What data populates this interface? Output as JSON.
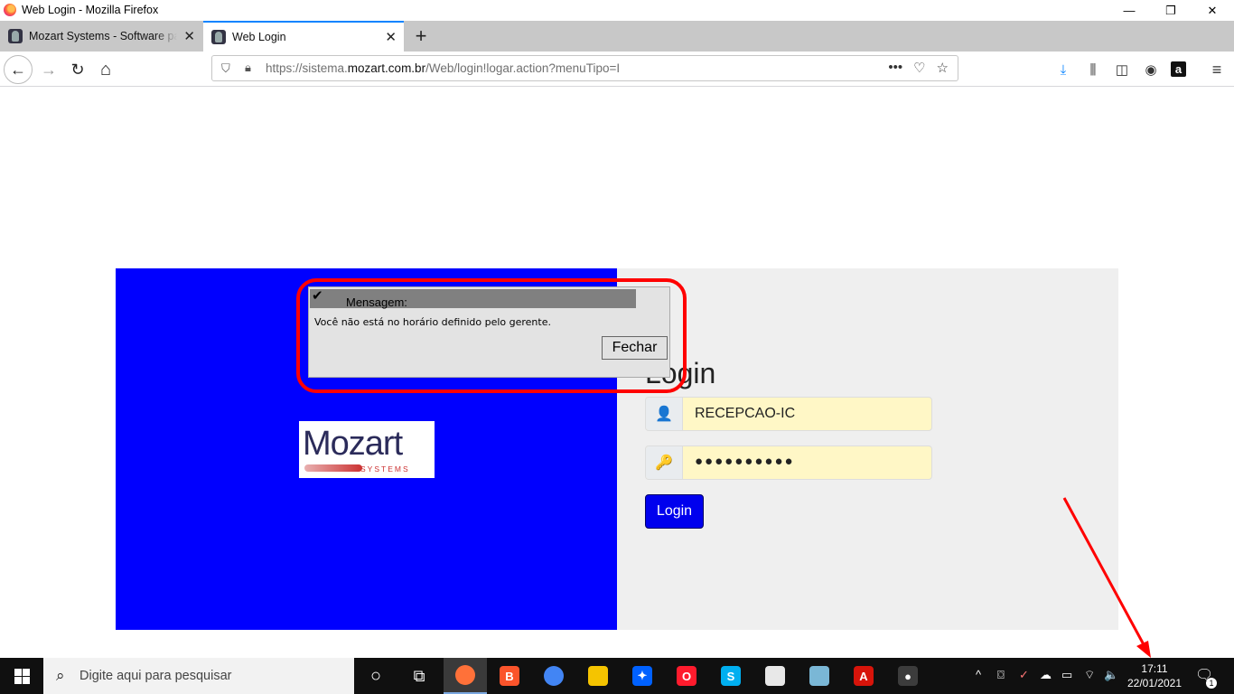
{
  "window": {
    "title": "Web Login - Mozilla Firefox",
    "minimize": "—",
    "restore": "❐",
    "close": "✕"
  },
  "tabs": [
    {
      "label": "Mozart Systems - Software para",
      "close": "✕"
    },
    {
      "label": "Web Login",
      "close": "✕"
    }
  ],
  "new_tab": "+",
  "nav": {
    "back": "←",
    "forward": "→",
    "reload": "↻",
    "home": "⌂",
    "url_pre": "https://sistema.",
    "url_domain": "mozart.com.br",
    "url_post": "/Web/login!logar.action?menuTipo=I",
    "page_actions": "•••",
    "pocket": "♡",
    "bookmark": "☆",
    "download": "⤓",
    "library": "⫼",
    "sidebar": "◫",
    "account": "◉",
    "amazon": "a",
    "menu": "≡"
  },
  "logo": {
    "word": "Mozart",
    "sub": "SYSTEMS"
  },
  "login": {
    "title": "Login",
    "username": "RECEPCAO-IC",
    "password": "●●●●●●●●●●",
    "button": "Login",
    "user_icon": "👤",
    "key_icon": "🔑"
  },
  "dialog": {
    "check": "✔",
    "title": "Mensagem:",
    "message": "Você não está no horário definido pelo gerente.",
    "close_button": "Fechar"
  },
  "taskbar": {
    "search_placeholder": "Digite aqui para pesquisar",
    "search_icon": "⌕",
    "cortana": "○",
    "task_view": "⧉",
    "apps": [
      {
        "name": "firefox",
        "glyph": "",
        "color": "#ff7139"
      },
      {
        "name": "brave",
        "glyph": "B",
        "color": "#fb542b"
      },
      {
        "name": "chrome",
        "glyph": "",
        "color": "#4285f4"
      },
      {
        "name": "file-explorer",
        "glyph": "",
        "color": "#f5c400"
      },
      {
        "name": "dropbox",
        "glyph": "✦",
        "color": "#0061ff"
      },
      {
        "name": "opera",
        "glyph": "O",
        "color": "#ff1b2d"
      },
      {
        "name": "skype",
        "glyph": "S",
        "color": "#00aff0"
      },
      {
        "name": "app-anydesk",
        "glyph": "",
        "color": "#e8e8e8"
      },
      {
        "name": "app-notes",
        "glyph": "",
        "color": "#7ab7d6"
      },
      {
        "name": "acrobat",
        "glyph": "A",
        "color": "#d7140a"
      },
      {
        "name": "obs",
        "glyph": "●",
        "color": "#3c3c3c"
      }
    ],
    "tray": {
      "chevron": "^",
      "meet": "⌼",
      "defender": "✓",
      "onedrive": "☁",
      "battery": "▭",
      "wifi": "⌔",
      "volume": "🔈",
      "time": "17:11",
      "date": "22/01/2021",
      "notifications": "🗨",
      "notification_count": "1"
    }
  }
}
